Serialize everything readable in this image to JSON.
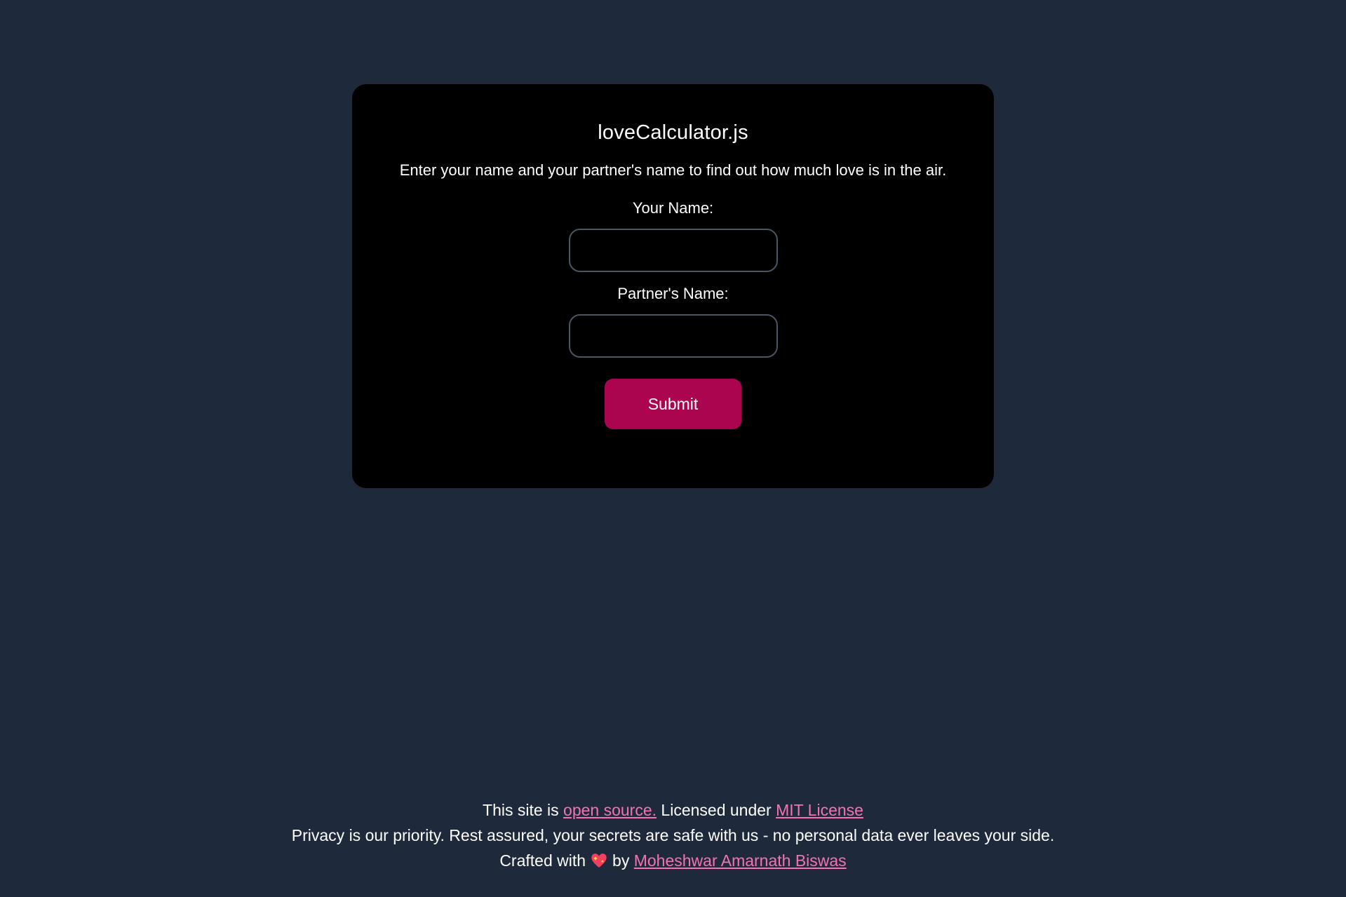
{
  "app": {
    "title": "loveCalculator.js",
    "description": "Enter your name and your partner's name to find out how much love is in the air."
  },
  "form": {
    "your_name_label": "Your Name:",
    "your_name_value": "",
    "partner_name_label": "Partner's Name:",
    "partner_name_value": "",
    "submit_label": "Submit"
  },
  "footer": {
    "line1_prefix": "This site is ",
    "open_source_link": "open source.",
    "line1_middle": " Licensed under ",
    "license_link": "MIT License",
    "line2": "Privacy is our priority. Rest assured, your secrets are safe with us - no personal data ever leaves your side.",
    "line3_prefix": "Crafted with",
    "line3_by": "by",
    "author_link": "Moheshwar Amarnath Biswas",
    "heart_icon": "sparkling-heart-icon"
  },
  "colors": {
    "background": "#1e293b",
    "card": "#000000",
    "accent_button": "#ab0550",
    "link": "#f472b6"
  }
}
